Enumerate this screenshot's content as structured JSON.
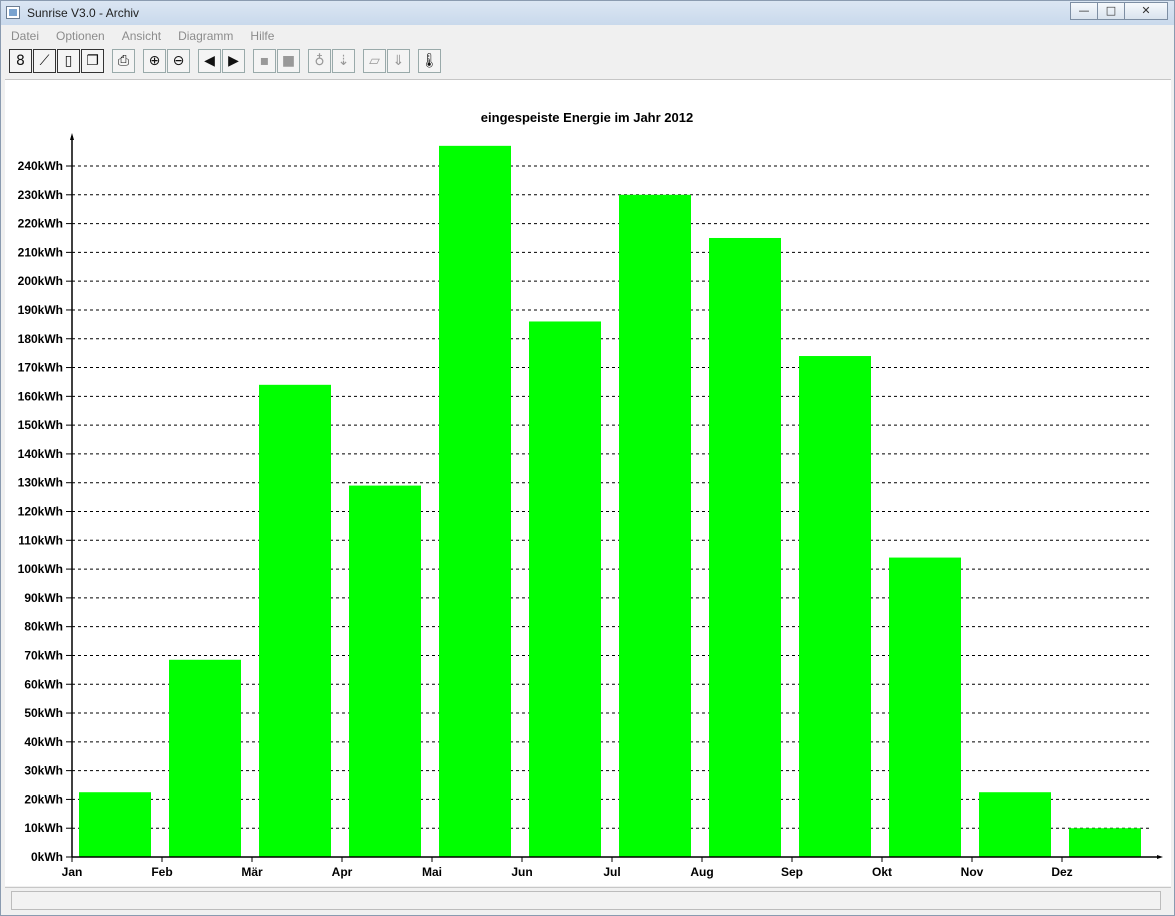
{
  "window": {
    "title": "Sunrise V3.0 - Archiv"
  },
  "menu": [
    "Datei",
    "Optionen",
    "Ansicht",
    "Diagramm",
    "Hilfe"
  ],
  "toolbar": [
    {
      "name": "overview-icon",
      "glyph": "8"
    },
    {
      "name": "line-chart-icon",
      "glyph": "⟋"
    },
    {
      "name": "page-icon",
      "glyph": "▯"
    },
    {
      "name": "windows-icon",
      "glyph": "❐"
    },
    {
      "name": "print-icon",
      "glyph": "⎙"
    },
    {
      "name": "zoom-in-icon",
      "glyph": "⊕"
    },
    {
      "name": "zoom-out-icon",
      "glyph": "⊖"
    },
    {
      "name": "previous-icon",
      "glyph": "◀"
    },
    {
      "name": "next-icon",
      "glyph": "▶"
    },
    {
      "name": "day-icon",
      "glyph": "▪"
    },
    {
      "name": "month-icon",
      "glyph": "■"
    },
    {
      "name": "plug-icon",
      "glyph": "♁"
    },
    {
      "name": "plug-down-icon",
      "glyph": "⇣"
    },
    {
      "name": "panel-icon",
      "glyph": "▱"
    },
    {
      "name": "panel-down-icon",
      "glyph": "⇓"
    },
    {
      "name": "thermometer-icon",
      "glyph": "🌡"
    }
  ],
  "colors": {
    "bar": "#00ff00",
    "axis": "#000000",
    "grid": "#000000"
  },
  "chart_data": {
    "type": "bar",
    "title": "eingespeiste Energie im Jahr 2012",
    "categories": [
      "Jan",
      "Feb",
      "Mär",
      "Apr",
      "Mai",
      "Jun",
      "Jul",
      "Aug",
      "Sep",
      "Okt",
      "Nov",
      "Dez"
    ],
    "values": [
      22.5,
      68.5,
      164,
      129,
      247,
      186,
      230,
      215,
      174,
      104,
      22.5,
      10
    ],
    "y_unit": "kWh",
    "ylim": [
      0,
      240
    ],
    "ytick_step": 10,
    "yticks": [
      "0kWh",
      "10kWh",
      "20kWh",
      "30kWh",
      "40kWh",
      "50kWh",
      "60kWh",
      "70kWh",
      "80kWh",
      "90kWh",
      "100kWh",
      "110kWh",
      "120kWh",
      "130kWh",
      "140kWh",
      "150kWh",
      "160kWh",
      "170kWh",
      "180kWh",
      "190kWh",
      "200kWh",
      "210kWh",
      "220kWh",
      "230kWh",
      "240kWh"
    ],
    "grid": true,
    "grid_style": "dashed",
    "legend": "none"
  }
}
